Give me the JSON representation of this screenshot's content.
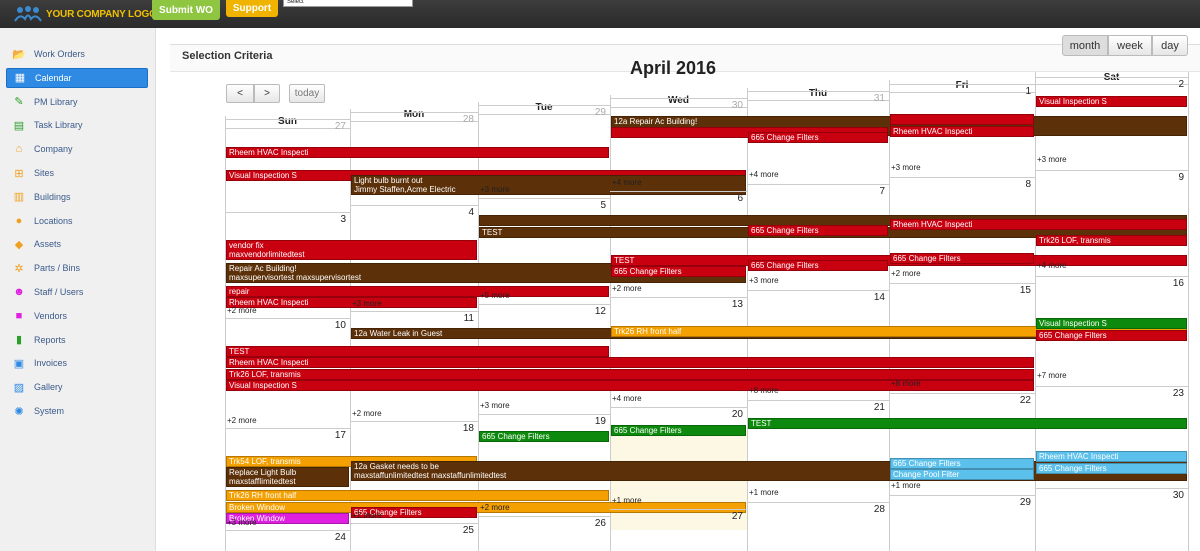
{
  "header": {
    "logo_text": "YOUR COMPANY LOGO",
    "submit_label": "Submit WO",
    "support_label": "Support",
    "select_value": "Select"
  },
  "sidebar": {
    "items": [
      {
        "label": "Work Orders",
        "icon": "folder-icon",
        "color": "#5aa02c"
      },
      {
        "label": "Calendar",
        "icon": "calendar-icon",
        "color": "#5aa02c"
      },
      {
        "label": "PM Library",
        "icon": "pencil-icon",
        "color": "#2aa02a"
      },
      {
        "label": "Task Library",
        "icon": "book-icon",
        "color": "#2aa02a"
      },
      {
        "label": "Company",
        "icon": "home-icon",
        "color": "#f0a020"
      },
      {
        "label": "Sites",
        "icon": "sitemap-icon",
        "color": "#f0a020"
      },
      {
        "label": "Buildings",
        "icon": "building-icon",
        "color": "#f0a020"
      },
      {
        "label": "Locations",
        "icon": "map-marker-icon",
        "color": "#f0a020"
      },
      {
        "label": "Assets",
        "icon": "tags-icon",
        "color": "#f0a020"
      },
      {
        "label": "Parts / Bins",
        "icon": "cogs-icon",
        "color": "#f0a020"
      },
      {
        "label": "Staff / Users",
        "icon": "users-icon",
        "color": "#e020e0"
      },
      {
        "label": "Vendors",
        "icon": "truck-icon",
        "color": "#e020e0"
      },
      {
        "label": "Reports",
        "icon": "bar-chart-icon",
        "color": "#2aa02a"
      },
      {
        "label": "Invoices",
        "icon": "dollar-icon",
        "color": "#2f8ae4"
      },
      {
        "label": "Gallery",
        "icon": "image-icon",
        "color": "#2f8ae4"
      },
      {
        "label": "System",
        "icon": "gear-icon",
        "color": "#2f8ae4"
      }
    ],
    "active_index": 1
  },
  "criteria": {
    "title": "Selection Criteria"
  },
  "views": {
    "month": "month",
    "week": "week",
    "day": "day"
  },
  "nav": {
    "prev": "<",
    "next": ">",
    "today": "today"
  },
  "calendar": {
    "title": "April 2016",
    "days": [
      "Sun",
      "Mon",
      "Tue",
      "Wed",
      "Thu",
      "Fri",
      "Sat"
    ],
    "weeks": [
      {
        "nums": [
          "27",
          "28",
          "29",
          "30",
          "31",
          "1",
          "2"
        ],
        "other": [
          true,
          true,
          true,
          true,
          true,
          false,
          false
        ],
        "events": [
          {
            "col": 3,
            "span": 4,
            "row": 0,
            "lines": [
              "12a Repair Ac Building!",
              "maxsupervisortest maxsupervisortest"
            ],
            "color": "brn"
          },
          {
            "col": 0,
            "span": 3,
            "row": 1,
            "lines": [
              "Rheem HVAC Inspecti"
            ],
            "color": "red"
          },
          {
            "col": 3,
            "span": 2,
            "row": 1,
            "lines": [
              ""
            ],
            "color": "red"
          },
          {
            "col": 5,
            "span": 1,
            "row": 1,
            "lines": [
              ""
            ],
            "color": "red"
          },
          {
            "col": 6,
            "span": 1,
            "row": 0,
            "lines": [
              "Visual Inspection S"
            ],
            "color": "red"
          },
          {
            "col": 4,
            "span": 1,
            "row": 2,
            "lines": [
              "665 Change Filters"
            ],
            "color": "red"
          },
          {
            "col": 5,
            "span": 1,
            "row": 2,
            "lines": [
              "Rheem HVAC Inspecti"
            ],
            "color": "red"
          },
          {
            "col": 0,
            "span": 4,
            "row": 3,
            "lines": [
              "Visual Inspection S"
            ],
            "color": "red"
          },
          {
            "col": 1,
            "span": 3,
            "row": 4,
            "lines": [
              "Light bulb burnt out",
              "Jimmy Staffen,Acme Electric"
            ],
            "color": "brn"
          }
        ],
        "more": [
          {
            "col": 2,
            "text": "+3 more"
          },
          {
            "col": 3,
            "text": "+4 more"
          },
          {
            "col": 4,
            "text": "+4 more"
          },
          {
            "col": 5,
            "text": "+3 more"
          },
          {
            "col": 6,
            "text": "+3 more"
          }
        ]
      },
      {
        "nums": [
          "3",
          "4",
          "5",
          "6",
          "7",
          "8",
          "9"
        ],
        "other": [
          false,
          false,
          false,
          false,
          false,
          false,
          false
        ],
        "events": [
          {
            "col": 2,
            "span": 5,
            "row": 0,
            "lines": [
              ""
            ],
            "color": "brn"
          },
          {
            "col": 0,
            "span": 2,
            "row": 1,
            "lines": [
              "vendor fix",
              "maxvendorlimitedtest"
            ],
            "color": "red"
          },
          {
            "col": 2,
            "span": 5,
            "row": 1,
            "lines": [
              "TEST"
            ],
            "color": "brn"
          },
          {
            "col": 4,
            "span": 1,
            "row": 2,
            "lines": [
              "665 Change Filters"
            ],
            "color": "red"
          },
          {
            "col": 5,
            "span": 2,
            "row": 2,
            "lines": [
              "Rheem HVAC Inspecti"
            ],
            "color": "red"
          },
          {
            "col": 0,
            "span": 4,
            "row": 3,
            "lines": [
              "Repair Ac Building!",
              "maxsupervisortest maxsupervisortest"
            ],
            "color": "brn"
          },
          {
            "col": 3,
            "span": 4,
            "row": 4,
            "lines": [
              "TEST"
            ],
            "color": "red"
          },
          {
            "col": 0,
            "span": 3,
            "row": 5,
            "lines": [
              "repair"
            ],
            "color": "red"
          },
          {
            "col": 3,
            "span": 1,
            "row": 5,
            "lines": [
              "665 Change Filters"
            ],
            "color": "red"
          },
          {
            "col": 4,
            "span": 1,
            "row": 5,
            "lines": [
              "665 Change Filters"
            ],
            "color": "red"
          },
          {
            "col": 5,
            "span": 1,
            "row": 5,
            "lines": [
              "665 Change Filters"
            ],
            "color": "red"
          },
          {
            "col": 6,
            "span": 1,
            "row": 4,
            "lines": [
              "Trk26 LOF, transmis"
            ],
            "color": "red"
          },
          {
            "col": 0,
            "span": 2,
            "row": 6,
            "lines": [
              "Rheem HVAC Inspecti"
            ],
            "color": "red"
          }
        ],
        "more": [
          {
            "col": 0,
            "text": "+2 more"
          },
          {
            "col": 1,
            "text": "+3 more"
          },
          {
            "col": 2,
            "text": "+5 more"
          },
          {
            "col": 3,
            "text": "+2 more"
          },
          {
            "col": 4,
            "text": "+3 more"
          },
          {
            "col": 5,
            "text": "+2 more"
          },
          {
            "col": 6,
            "text": "+4 more"
          }
        ]
      },
      {
        "nums": [
          "10",
          "11",
          "12",
          "13",
          "14",
          "15",
          "16"
        ],
        "other": [
          false,
          false,
          false,
          false,
          false,
          false,
          false
        ],
        "events": [
          {
            "col": 1,
            "span": 6,
            "row": 0,
            "lines": [
              "12a Water Leak in Guest"
            ],
            "color": "brn"
          },
          {
            "col": 0,
            "span": 3,
            "row": 1,
            "lines": [
              "TEST"
            ],
            "color": "red"
          },
          {
            "col": 3,
            "span": 4,
            "row": 1,
            "lines": [
              "Trk26 RH front half"
            ],
            "color": "org"
          },
          {
            "col": 0,
            "span": 6,
            "row": 2,
            "lines": [
              "Rheem HVAC Inspecti"
            ],
            "color": "red"
          },
          {
            "col": 6,
            "span": 1,
            "row": 2,
            "lines": [
              "Visual Inspection S"
            ],
            "color": "grn"
          },
          {
            "col": 0,
            "span": 6,
            "row": 3,
            "lines": [
              "Trk26 LOF, transmis"
            ],
            "color": "red"
          },
          {
            "col": 6,
            "span": 1,
            "row": 3,
            "lines": [
              "665 Change Filters"
            ],
            "color": "red"
          },
          {
            "col": 0,
            "span": 6,
            "row": 4,
            "lines": [
              "Visual Inspection S"
            ],
            "color": "red"
          }
        ],
        "more": [
          {
            "col": 0,
            "text": "+2 more"
          },
          {
            "col": 1,
            "text": "+2 more"
          },
          {
            "col": 2,
            "text": "+3 more"
          },
          {
            "col": 3,
            "text": "+4 more"
          },
          {
            "col": 4,
            "text": "+8 more"
          },
          {
            "col": 5,
            "text": "+8 more"
          },
          {
            "col": 6,
            "text": "+7 more"
          }
        ]
      },
      {
        "nums": [
          "17",
          "18",
          "19",
          "20",
          "21",
          "22",
          "23"
        ],
        "other": [
          false,
          false,
          false,
          false,
          false,
          false,
          false
        ],
        "today_col": 3,
        "events": [
          {
            "col": 2,
            "span": 1,
            "row": 0,
            "lines": [
              "665 Change Filters"
            ],
            "color": "grn"
          },
          {
            "col": 3,
            "span": 1,
            "row": 0,
            "lines": [
              "665 Change Filters"
            ],
            "color": "grn"
          },
          {
            "col": 4,
            "span": 3,
            "row": 0,
            "lines": [
              "TEST"
            ],
            "color": "grn"
          },
          {
            "col": 0,
            "span": 2,
            "row": 1,
            "lines": [
              "Trk54 LOF, transmis"
            ],
            "color": "org"
          },
          {
            "col": 0,
            "span": 1,
            "row": 2,
            "lines": [
              "Replace Light Bulb",
              "maxstaffIimitedtest maxstaffunlimitedtest"
            ],
            "color": "brn"
          },
          {
            "col": 1,
            "span": 6,
            "row": 2,
            "lines": [
              "12a Gasket needs to be",
              "maxstaffunlimitedtest maxstaffunlimitedtest"
            ],
            "color": "brn"
          },
          {
            "col": 0,
            "span": 3,
            "row": 4,
            "lines": [
              "Trk26 RH front half"
            ],
            "color": "org"
          },
          {
            "col": 5,
            "span": 1,
            "row": 4,
            "lines": [
              "665 Change Filters"
            ],
            "color": "sky"
          },
          {
            "col": 6,
            "span": 1,
            "row": 4,
            "lines": [
              "Rheem HVAC Inspecti"
            ],
            "color": "sky"
          },
          {
            "col": 0,
            "span": 4,
            "row": 5,
            "lines": [
              "Broken Window"
            ],
            "color": "org"
          },
          {
            "col": 5,
            "span": 1,
            "row": 5,
            "lines": [
              "Change Pool Filter"
            ],
            "color": "sky"
          },
          {
            "col": 6,
            "span": 1,
            "row": 5,
            "lines": [
              "665 Change Filters"
            ],
            "color": "sky"
          },
          {
            "col": 0,
            "span": 1,
            "row": 6,
            "lines": [
              "Broken Window"
            ],
            "color": "mag"
          },
          {
            "col": 1,
            "span": 1,
            "row": 6,
            "lines": [
              "665 Change Filters"
            ],
            "color": "red"
          }
        ],
        "more": [
          {
            "col": 0,
            "text": "+3 more"
          },
          {
            "col": 1,
            "text": "+2 more"
          },
          {
            "col": 2,
            "text": "+2 more"
          },
          {
            "col": 3,
            "text": "+1 more"
          },
          {
            "col": 4,
            "text": "+1 more"
          },
          {
            "col": 5,
            "text": "+1 more"
          }
        ]
      },
      {
        "nums": [
          "24",
          "25",
          "26",
          "27",
          "28",
          "29",
          "30"
        ],
        "other": [
          false,
          false,
          false,
          false,
          false,
          false,
          false
        ],
        "events": [],
        "more": []
      }
    ]
  }
}
